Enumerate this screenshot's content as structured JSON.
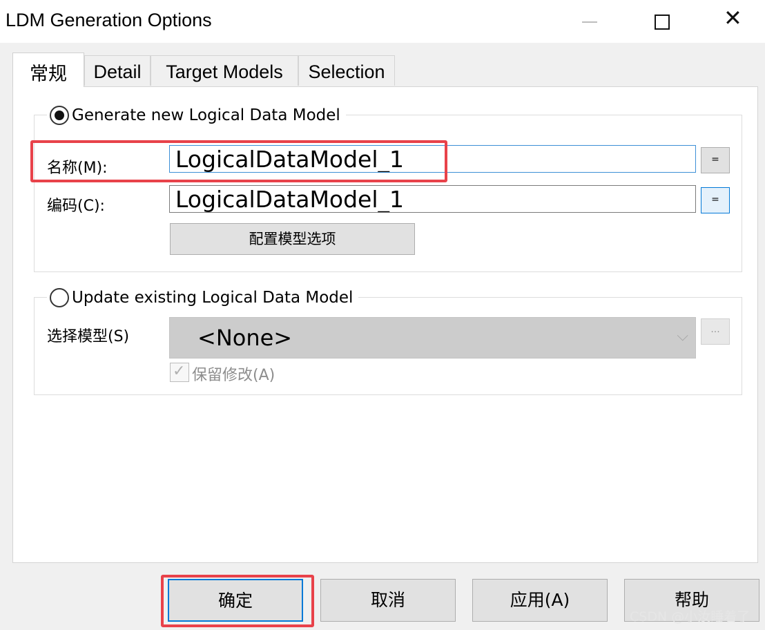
{
  "window": {
    "title": "LDM Generation Options",
    "minimize_icon": "minimize-icon",
    "maximize_icon": "maximize-icon",
    "close_icon": "close-icon",
    "close_glyph": "✕"
  },
  "tabs": [
    {
      "label": "常规",
      "active": true
    },
    {
      "label": "Detail",
      "active": false
    },
    {
      "label": "Target Models",
      "active": false
    },
    {
      "label": "Selection",
      "active": false
    }
  ],
  "generate_group": {
    "option_label": "Generate new Logical Data Model",
    "selected": true,
    "name_label": "名称(M):",
    "name_value": "LogicalDataModel_1",
    "name_eq_label": "=",
    "code_label": "编码(C):",
    "code_value": "LogicalDataModel_1",
    "code_eq_label": "=",
    "config_button_label": "配置模型选项"
  },
  "update_group": {
    "option_label": "Update existing Logical Data Model",
    "selected": false,
    "model_label": "选择模型(S)",
    "model_value": "<None>",
    "dropdown_icon": "chevron-down-icon",
    "chevron_glyph": "⌵",
    "browse_label": "...",
    "keep_changes_label": "保留修改(A)",
    "keep_changes_checked": true,
    "check_glyph": "✓"
  },
  "footer": {
    "ok_label": "确定",
    "cancel_label": "取消",
    "apply_label": "应用(A)",
    "help_label": "帮助"
  },
  "watermark": "CSDN @小汝睡着了",
  "colors": {
    "highlight": "#e8424a",
    "focus_border": "#3c8fd6",
    "default_button_border": "#0078d7"
  }
}
